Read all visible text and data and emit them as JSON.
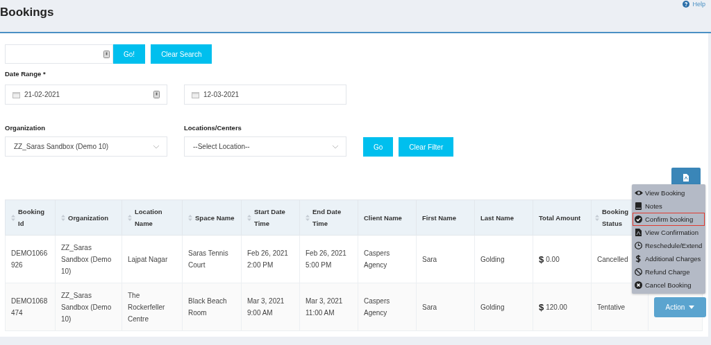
{
  "page": {
    "title": "Bookings",
    "help_link": "Help"
  },
  "search": {
    "go_button": "Go!",
    "clear_button": "Clear Search"
  },
  "date_range": {
    "label": "Date Range *",
    "from": "21-02-2021",
    "to": "12-03-2021"
  },
  "filters": {
    "organization_label": "Organization",
    "organization_value": "ZZ_Saras Sandbox (Demo 10)",
    "location_label": "Locations/Centers",
    "location_value": "--Select Location--",
    "go_button": "Go",
    "clear_button": "Clear Filter"
  },
  "table": {
    "columns": [
      {
        "label": "Booking Id",
        "sortable": true
      },
      {
        "label": "Organization",
        "sortable": true
      },
      {
        "label": "Location Name",
        "sortable": true
      },
      {
        "label": "Space Name",
        "sortable": true
      },
      {
        "label": "Start Date Time",
        "sortable": true
      },
      {
        "label": "End Date Time",
        "sortable": true
      },
      {
        "label": "Client Name",
        "sortable": false
      },
      {
        "label": "First Name",
        "sortable": false
      },
      {
        "label": "Last Name",
        "sortable": false
      },
      {
        "label": "Total Amount",
        "sortable": false
      },
      {
        "label": "Booking Status",
        "sortable": true
      }
    ],
    "rows": [
      {
        "cells": [
          "DEMO1066 926",
          "ZZ_Saras Sandbox (Demo 10)",
          "Lajpat Nagar",
          "Saras Tennis Court",
          "Feb 26, 2021 2:00 PM",
          "Feb 26, 2021 5:00 PM",
          "Caspers Agency",
          "Sara",
          "Golding",
          "0.00",
          "Cancelled"
        ]
      },
      {
        "cells": [
          "DEMO1068 474",
          "ZZ_Saras Sandbox (Demo 10)",
          "The Rockerfeller Centre",
          "Black Beach Room",
          "Mar 3, 2021 9:00 AM",
          "Mar 3, 2021 11:00 AM",
          "Caspers Agency",
          "Sara",
          "Golding",
          "120.00",
          "Tentative"
        ],
        "action_button": "Action"
      }
    ]
  },
  "currency_symbol": "$",
  "action_menu": [
    {
      "label": "View Booking",
      "kind": "eye",
      "selected": false
    },
    {
      "label": "Notes",
      "kind": "book",
      "selected": false
    },
    {
      "label": "Confirm booking",
      "kind": "check",
      "selected": true
    },
    {
      "label": "View Confirmation",
      "kind": "pdf",
      "selected": false
    },
    {
      "label": "Reschedule/Extend",
      "kind": "clock",
      "selected": false
    },
    {
      "label": "Additional Charges",
      "kind": "dollar",
      "selected": false
    },
    {
      "label": "Refund Charge",
      "kind": "ban",
      "selected": false
    },
    {
      "label": "Cancel Booking",
      "kind": "cross",
      "selected": false
    }
  ]
}
